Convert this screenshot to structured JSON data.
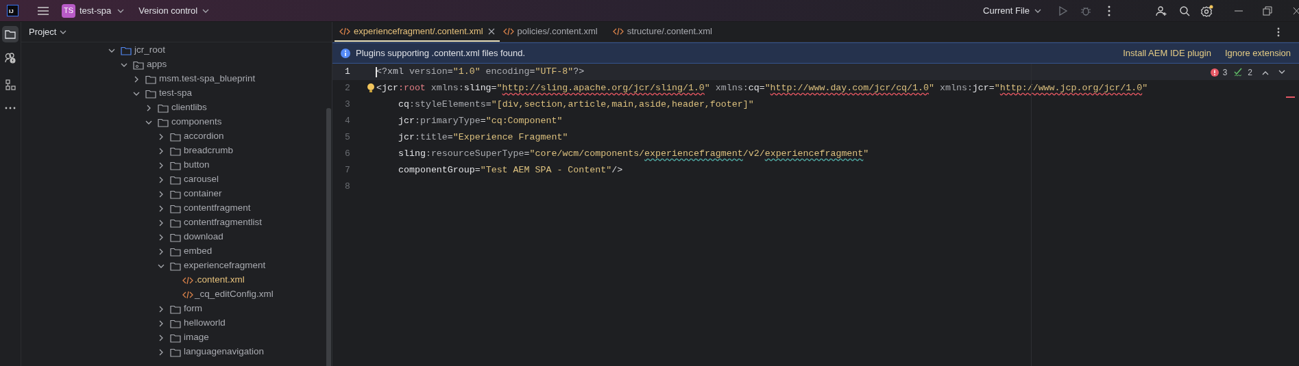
{
  "title_bar": {
    "logo": "IJ",
    "project_badge": "TS",
    "project_name": "test-spa",
    "vcs": "Version control",
    "run_config": "Current File"
  },
  "project_panel": {
    "title": "Project",
    "tree": [
      {
        "name": "jcr_root",
        "kind": "source_root",
        "expanded": true,
        "children": [
          {
            "name": "apps",
            "kind": "package",
            "expanded": true,
            "children": [
              {
                "name": "msm.test-spa_blueprint",
                "kind": "folder",
                "expanded": false
              },
              {
                "name": "test-spa",
                "kind": "folder",
                "expanded": true,
                "children": [
                  {
                    "name": "clientlibs",
                    "kind": "folder",
                    "expanded": false
                  },
                  {
                    "name": "components",
                    "kind": "folder",
                    "expanded": true,
                    "children": [
                      {
                        "name": "accordion",
                        "kind": "folder",
                        "expanded": false
                      },
                      {
                        "name": "breadcrumb",
                        "kind": "folder",
                        "expanded": false
                      },
                      {
                        "name": "button",
                        "kind": "folder",
                        "expanded": false
                      },
                      {
                        "name": "carousel",
                        "kind": "folder",
                        "expanded": false
                      },
                      {
                        "name": "container",
                        "kind": "folder",
                        "expanded": false
                      },
                      {
                        "name": "contentfragment",
                        "kind": "folder",
                        "expanded": false
                      },
                      {
                        "name": "contentfragmentlist",
                        "kind": "folder",
                        "expanded": false
                      },
                      {
                        "name": "download",
                        "kind": "folder",
                        "expanded": false
                      },
                      {
                        "name": "embed",
                        "kind": "folder",
                        "expanded": false
                      },
                      {
                        "name": "experiencefragment",
                        "kind": "folder",
                        "expanded": true,
                        "children": [
                          {
                            "name": ".content.xml",
                            "kind": "xml",
                            "current": true
                          },
                          {
                            "name": "_cq_editConfig.xml",
                            "kind": "xml",
                            "current": false
                          }
                        ]
                      },
                      {
                        "name": "form",
                        "kind": "folder",
                        "expanded": false
                      },
                      {
                        "name": "helloworld",
                        "kind": "folder",
                        "expanded": false
                      },
                      {
                        "name": "image",
                        "kind": "folder",
                        "expanded": false
                      },
                      {
                        "name": "languagenavigation",
                        "kind": "folder",
                        "expanded": false
                      }
                    ]
                  }
                ]
              }
            ]
          }
        ]
      }
    ]
  },
  "tabs": [
    {
      "label": "experiencefragment/.content.xml",
      "selected": true
    },
    {
      "label": "policies/.content.xml",
      "selected": false
    },
    {
      "label": "structure/.content.xml",
      "selected": false
    }
  ],
  "banner": {
    "message": "Plugins supporting .content.xml files found.",
    "actions": [
      "Install AEM IDE plugin",
      "Ignore extension"
    ]
  },
  "inspections": {
    "errors": "3",
    "warnings": "2"
  },
  "code": [
    {
      "number": "1",
      "current": true,
      "indent": false,
      "segments": [
        {
          "text": "<?xml",
          "kind": "pi"
        },
        {
          "text": " version",
          "kind": "local"
        },
        {
          "text": "=",
          "kind": "punct"
        },
        {
          "text": "\"1.0\"",
          "kind": "value"
        },
        {
          "text": " encoding",
          "kind": "local"
        },
        {
          "text": "=",
          "kind": "punct"
        },
        {
          "text": "\"UTF-8\"",
          "kind": "value"
        },
        {
          "text": "?>",
          "kind": "pi"
        }
      ]
    },
    {
      "number": "2",
      "current": false,
      "indent": false,
      "segments": [
        {
          "text": "<",
          "kind": "punct"
        },
        {
          "text": "jcr",
          "kind": "name"
        },
        {
          "text": ":root",
          "kind": "tag"
        },
        {
          "text": " xmlns:",
          "kind": "local"
        },
        {
          "text": "sling",
          "kind": "name"
        },
        {
          "text": "=",
          "kind": "punct"
        },
        {
          "text": "\"",
          "kind": "value"
        },
        {
          "text": "http://sling.apache.org/jcr/sling/1.0",
          "kind": "value_error"
        },
        {
          "text": "\"",
          "kind": "value"
        },
        {
          "text": " xmlns:",
          "kind": "local"
        },
        {
          "text": "cq",
          "kind": "name"
        },
        {
          "text": "=",
          "kind": "punct"
        },
        {
          "text": "\"",
          "kind": "value"
        },
        {
          "text": "http://www.day.com/jcr/cq/1.0",
          "kind": "value_error"
        },
        {
          "text": "\"",
          "kind": "value"
        },
        {
          "text": " xmlns:",
          "kind": "local"
        },
        {
          "text": "jcr",
          "kind": "name"
        },
        {
          "text": "=",
          "kind": "punct"
        },
        {
          "text": "\"",
          "kind": "value"
        },
        {
          "text": "http://www.jcp.org/jcr/1.0",
          "kind": "value_error"
        },
        {
          "text": "\"",
          "kind": "value"
        }
      ]
    },
    {
      "number": "3",
      "current": false,
      "indent": true,
      "segments": [
        {
          "text": "cq",
          "kind": "name"
        },
        {
          "text": ":styleElements",
          "kind": "local"
        },
        {
          "text": "=",
          "kind": "punct"
        },
        {
          "text": "\"[div,section,article,main,aside,header,footer]\"",
          "kind": "value"
        }
      ]
    },
    {
      "number": "4",
      "current": false,
      "indent": true,
      "segments": [
        {
          "text": "jcr",
          "kind": "name"
        },
        {
          "text": ":primaryType",
          "kind": "local"
        },
        {
          "text": "=",
          "kind": "punct"
        },
        {
          "text": "\"cq:Component\"",
          "kind": "value"
        }
      ]
    },
    {
      "number": "5",
      "current": false,
      "indent": true,
      "segments": [
        {
          "text": "jcr",
          "kind": "name"
        },
        {
          "text": ":title",
          "kind": "local"
        },
        {
          "text": "=",
          "kind": "punct"
        },
        {
          "text": "\"Experience Fragment\"",
          "kind": "value"
        }
      ]
    },
    {
      "number": "6",
      "current": false,
      "indent": true,
      "segments": [
        {
          "text": "sling",
          "kind": "name"
        },
        {
          "text": ":resourceSuperType",
          "kind": "local"
        },
        {
          "text": "=",
          "kind": "punct"
        },
        {
          "text": "\"core/wcm/components/",
          "kind": "value"
        },
        {
          "text": "experiencefragment",
          "kind": "value_typo"
        },
        {
          "text": "/v2/",
          "kind": "value"
        },
        {
          "text": "experiencefragment",
          "kind": "value_typo"
        },
        {
          "text": "\"",
          "kind": "value"
        }
      ]
    },
    {
      "number": "7",
      "current": false,
      "indent": true,
      "segments": [
        {
          "text": "componentGroup",
          "kind": "name"
        },
        {
          "text": "=",
          "kind": "punct"
        },
        {
          "text": "\"Test AEM SPA - Content\"",
          "kind": "value"
        },
        {
          "text": "/>",
          "kind": "punct"
        }
      ]
    },
    {
      "number": "8",
      "current": false
    }
  ]
}
